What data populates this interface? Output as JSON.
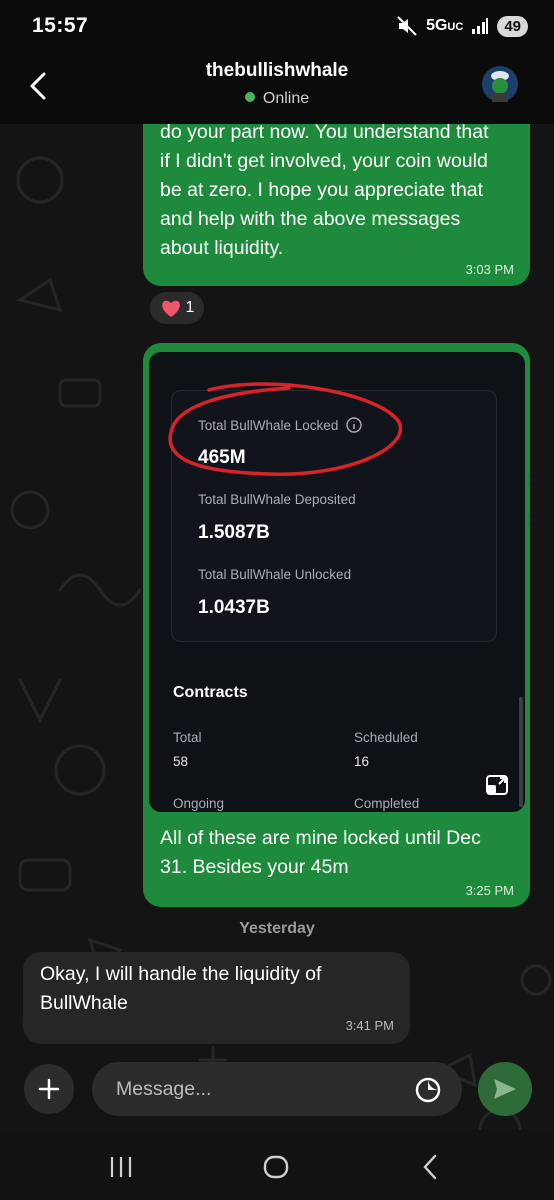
{
  "status_bar": {
    "time": "15:57",
    "network": "5G",
    "network_sub": "UC",
    "battery": "49"
  },
  "header": {
    "contact_name": "thebullishwhale",
    "presence": "Online"
  },
  "messages": [
    {
      "direction": "out",
      "lines": [
        "do your part now. You understand that",
        "if I didn't get involved, your coin would",
        "be at zero. I hope you appreciate that",
        "and help with the above messages",
        "about liquidity."
      ],
      "time": "3:03 PM",
      "reaction": {
        "emoji": "❤️",
        "count": "1"
      }
    },
    {
      "direction": "out",
      "image": {
        "stats": [
          {
            "label": "Total BullWhale Locked",
            "value": "465M"
          },
          {
            "label": "Total BullWhale Deposited",
            "value": "1.5087B"
          },
          {
            "label": "Total BullWhale Unlocked",
            "value": "1.0437B"
          }
        ],
        "contracts_title": "Contracts",
        "contracts": [
          {
            "label": "Total",
            "value": "58"
          },
          {
            "label": "Scheduled",
            "value": "16"
          },
          {
            "label": "Ongoing",
            "value": ""
          },
          {
            "label": "Completed",
            "value": ""
          }
        ]
      },
      "lines": [
        "All of these are mine locked until Dec",
        "31. Besides your 45m"
      ],
      "time": "3:25 PM"
    },
    {
      "direction": "in",
      "lines": [
        "Okay, I will handle the liquidity of",
        "BullWhale"
      ],
      "time": "3:41 PM"
    }
  ],
  "date_separator": "Yesterday",
  "composer": {
    "placeholder": "Message..."
  },
  "colors": {
    "outgoing_bubble": "#1e8a3b",
    "incoming_bubble": "#262626",
    "online_dot": "#43b55c",
    "annotation_circle": "#d8232a"
  }
}
